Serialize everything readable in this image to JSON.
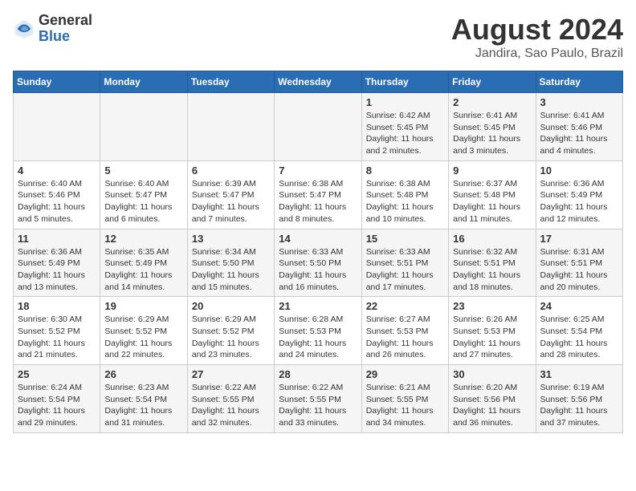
{
  "logo": {
    "general": "General",
    "blue": "Blue"
  },
  "title": "August 2024",
  "subtitle": "Jandira, Sao Paulo, Brazil",
  "weekdays": [
    "Sunday",
    "Monday",
    "Tuesday",
    "Wednesday",
    "Thursday",
    "Friday",
    "Saturday"
  ],
  "weeks": [
    [
      {
        "day": "",
        "sunrise": "",
        "sunset": "",
        "daylight": ""
      },
      {
        "day": "",
        "sunrise": "",
        "sunset": "",
        "daylight": ""
      },
      {
        "day": "",
        "sunrise": "",
        "sunset": "",
        "daylight": ""
      },
      {
        "day": "",
        "sunrise": "",
        "sunset": "",
        "daylight": ""
      },
      {
        "day": "1",
        "sunrise": "Sunrise: 6:42 AM",
        "sunset": "Sunset: 5:45 PM",
        "daylight": "Daylight: 11 hours and 2 minutes."
      },
      {
        "day": "2",
        "sunrise": "Sunrise: 6:41 AM",
        "sunset": "Sunset: 5:45 PM",
        "daylight": "Daylight: 11 hours and 3 minutes."
      },
      {
        "day": "3",
        "sunrise": "Sunrise: 6:41 AM",
        "sunset": "Sunset: 5:46 PM",
        "daylight": "Daylight: 11 hours and 4 minutes."
      }
    ],
    [
      {
        "day": "4",
        "sunrise": "Sunrise: 6:40 AM",
        "sunset": "Sunset: 5:46 PM",
        "daylight": "Daylight: 11 hours and 5 minutes."
      },
      {
        "day": "5",
        "sunrise": "Sunrise: 6:40 AM",
        "sunset": "Sunset: 5:47 PM",
        "daylight": "Daylight: 11 hours and 6 minutes."
      },
      {
        "day": "6",
        "sunrise": "Sunrise: 6:39 AM",
        "sunset": "Sunset: 5:47 PM",
        "daylight": "Daylight: 11 hours and 7 minutes."
      },
      {
        "day": "7",
        "sunrise": "Sunrise: 6:38 AM",
        "sunset": "Sunset: 5:47 PM",
        "daylight": "Daylight: 11 hours and 8 minutes."
      },
      {
        "day": "8",
        "sunrise": "Sunrise: 6:38 AM",
        "sunset": "Sunset: 5:48 PM",
        "daylight": "Daylight: 11 hours and 10 minutes."
      },
      {
        "day": "9",
        "sunrise": "Sunrise: 6:37 AM",
        "sunset": "Sunset: 5:48 PM",
        "daylight": "Daylight: 11 hours and 11 minutes."
      },
      {
        "day": "10",
        "sunrise": "Sunrise: 6:36 AM",
        "sunset": "Sunset: 5:49 PM",
        "daylight": "Daylight: 11 hours and 12 minutes."
      }
    ],
    [
      {
        "day": "11",
        "sunrise": "Sunrise: 6:36 AM",
        "sunset": "Sunset: 5:49 PM",
        "daylight": "Daylight: 11 hours and 13 minutes."
      },
      {
        "day": "12",
        "sunrise": "Sunrise: 6:35 AM",
        "sunset": "Sunset: 5:49 PM",
        "daylight": "Daylight: 11 hours and 14 minutes."
      },
      {
        "day": "13",
        "sunrise": "Sunrise: 6:34 AM",
        "sunset": "Sunset: 5:50 PM",
        "daylight": "Daylight: 11 hours and 15 minutes."
      },
      {
        "day": "14",
        "sunrise": "Sunrise: 6:33 AM",
        "sunset": "Sunset: 5:50 PM",
        "daylight": "Daylight: 11 hours and 16 minutes."
      },
      {
        "day": "15",
        "sunrise": "Sunrise: 6:33 AM",
        "sunset": "Sunset: 5:51 PM",
        "daylight": "Daylight: 11 hours and 17 minutes."
      },
      {
        "day": "16",
        "sunrise": "Sunrise: 6:32 AM",
        "sunset": "Sunset: 5:51 PM",
        "daylight": "Daylight: 11 hours and 18 minutes."
      },
      {
        "day": "17",
        "sunrise": "Sunrise: 6:31 AM",
        "sunset": "Sunset: 5:51 PM",
        "daylight": "Daylight: 11 hours and 20 minutes."
      }
    ],
    [
      {
        "day": "18",
        "sunrise": "Sunrise: 6:30 AM",
        "sunset": "Sunset: 5:52 PM",
        "daylight": "Daylight: 11 hours and 21 minutes."
      },
      {
        "day": "19",
        "sunrise": "Sunrise: 6:29 AM",
        "sunset": "Sunset: 5:52 PM",
        "daylight": "Daylight: 11 hours and 22 minutes."
      },
      {
        "day": "20",
        "sunrise": "Sunrise: 6:29 AM",
        "sunset": "Sunset: 5:52 PM",
        "daylight": "Daylight: 11 hours and 23 minutes."
      },
      {
        "day": "21",
        "sunrise": "Sunrise: 6:28 AM",
        "sunset": "Sunset: 5:53 PM",
        "daylight": "Daylight: 11 hours and 24 minutes."
      },
      {
        "day": "22",
        "sunrise": "Sunrise: 6:27 AM",
        "sunset": "Sunset: 5:53 PM",
        "daylight": "Daylight: 11 hours and 26 minutes."
      },
      {
        "day": "23",
        "sunrise": "Sunrise: 6:26 AM",
        "sunset": "Sunset: 5:53 PM",
        "daylight": "Daylight: 11 hours and 27 minutes."
      },
      {
        "day": "24",
        "sunrise": "Sunrise: 6:25 AM",
        "sunset": "Sunset: 5:54 PM",
        "daylight": "Daylight: 11 hours and 28 minutes."
      }
    ],
    [
      {
        "day": "25",
        "sunrise": "Sunrise: 6:24 AM",
        "sunset": "Sunset: 5:54 PM",
        "daylight": "Daylight: 11 hours and 29 minutes."
      },
      {
        "day": "26",
        "sunrise": "Sunrise: 6:23 AM",
        "sunset": "Sunset: 5:54 PM",
        "daylight": "Daylight: 11 hours and 31 minutes."
      },
      {
        "day": "27",
        "sunrise": "Sunrise: 6:22 AM",
        "sunset": "Sunset: 5:55 PM",
        "daylight": "Daylight: 11 hours and 32 minutes."
      },
      {
        "day": "28",
        "sunrise": "Sunrise: 6:22 AM",
        "sunset": "Sunset: 5:55 PM",
        "daylight": "Daylight: 11 hours and 33 minutes."
      },
      {
        "day": "29",
        "sunrise": "Sunrise: 6:21 AM",
        "sunset": "Sunset: 5:55 PM",
        "daylight": "Daylight: 11 hours and 34 minutes."
      },
      {
        "day": "30",
        "sunrise": "Sunrise: 6:20 AM",
        "sunset": "Sunset: 5:56 PM",
        "daylight": "Daylight: 11 hours and 36 minutes."
      },
      {
        "day": "31",
        "sunrise": "Sunrise: 6:19 AM",
        "sunset": "Sunset: 5:56 PM",
        "daylight": "Daylight: 11 hours and 37 minutes."
      }
    ]
  ]
}
